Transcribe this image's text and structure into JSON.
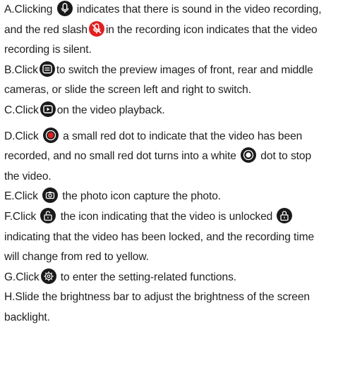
{
  "lines": [
    {
      "a": "A.Clicking",
      "b": "indicates that there is sound in the video recording,"
    },
    {
      "a": "and the red slash",
      "b": "in the recording icon indicates that the video"
    },
    {
      "a": "recording is silent."
    },
    {
      "a": "B.Click",
      "b": "to switch the preview images of front, rear and middle"
    },
    {
      "a": "cameras, or slide the screen left and right to switch."
    },
    {
      "a": "C.Click",
      "b": "on the video playback."
    },
    {
      "a": "D.Click",
      "b": "a small red dot to indicate that the video has been"
    },
    {
      "a": "recorded, and no small red dot turns into a white",
      "b": "dot to stop"
    },
    {
      "a": "the video."
    },
    {
      "a": "E.Click",
      "b": "the photo icon capture the photo."
    },
    {
      "a": "F.Click",
      "b": "the icon indicating that the video is unlocked"
    },
    {
      "a": "indicating that the video has been locked, and the recording time"
    },
    {
      "a": "will change from red to yellow."
    },
    {
      "a": "G.Click",
      "b": "to enter the setting-related functions."
    },
    {
      "a": "H.Slide the brightness bar to adjust the brightness of the screen"
    },
    {
      "a": "backlight."
    }
  ],
  "icons": {
    "mic": "microphone-icon",
    "mic_muted": "microphone-muted-icon",
    "switch": "camera-switch-icon",
    "playback": "playback-icon",
    "record": "record-red-dot-icon",
    "stop": "stop-white-dot-icon",
    "photo": "photo-camera-icon",
    "unlocked": "unlocked-icon",
    "locked": "locked-icon",
    "settings": "settings-gear-icon"
  },
  "colors": {
    "text": "#1e1e1e",
    "icon_bg": "#1a1a1a",
    "red": "#e02020"
  }
}
